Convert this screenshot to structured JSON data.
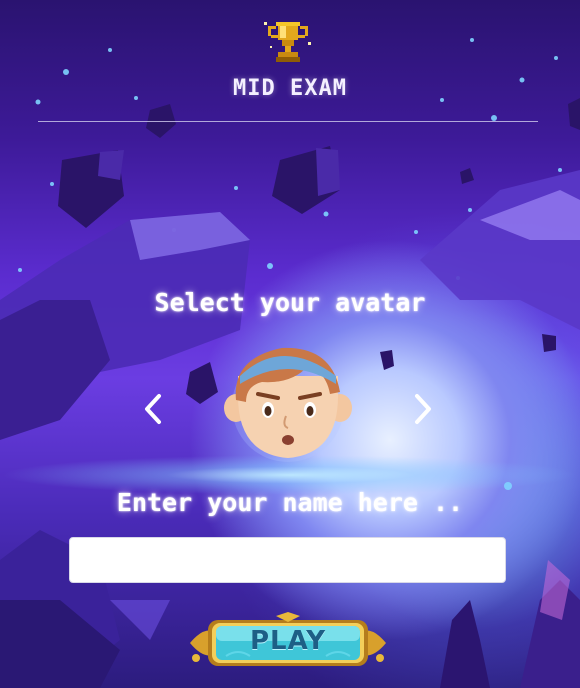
{
  "header": {
    "icon": "trophy-icon",
    "title": "MID EXAM"
  },
  "avatar_picker": {
    "label": "Select your avatar",
    "prev_icon": "chevron-left-icon",
    "next_icon": "chevron-right-icon",
    "current_avatar": "boy-with-headband-avatar"
  },
  "name_entry": {
    "label": "Enter your name here ..",
    "value": "",
    "placeholder": ""
  },
  "play_button": {
    "label": "PLAY"
  },
  "colors": {
    "title_text": "#f4f0ff",
    "accent_gold": "#e3a81c",
    "button_teal": "#3fc6d8",
    "sky_purple": "#5b2ccf"
  }
}
